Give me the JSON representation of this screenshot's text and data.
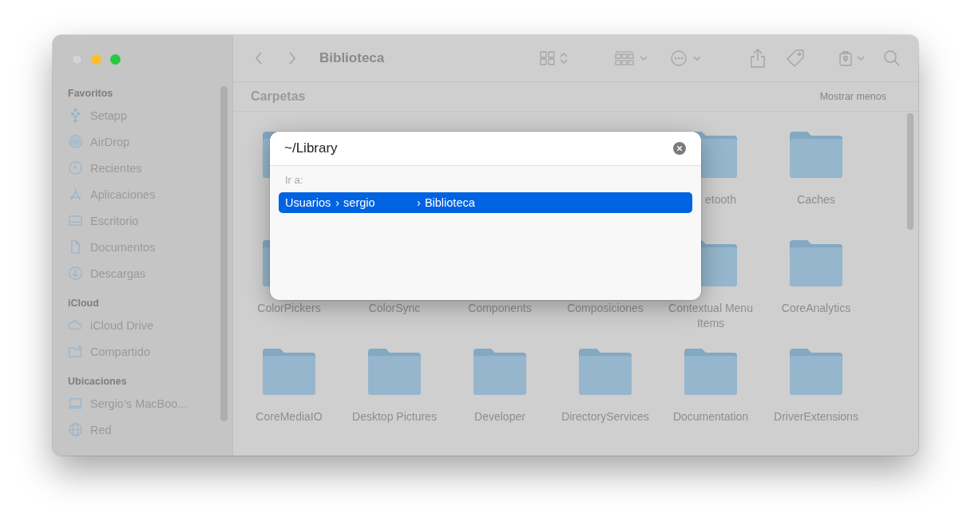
{
  "window": {
    "title": "Biblioteca"
  },
  "sidebar": {
    "sections": [
      {
        "heading": "Favoritos",
        "items": [
          {
            "label": "Setapp",
            "kind": "setapp"
          },
          {
            "label": "AirDrop",
            "kind": "airdrop"
          },
          {
            "label": "Recientes",
            "kind": "clock"
          },
          {
            "label": "Aplicaciones",
            "kind": "apps"
          },
          {
            "label": "Escritorio",
            "kind": "desktop"
          },
          {
            "label": "Documentos",
            "kind": "doc"
          },
          {
            "label": "Descargas",
            "kind": "download"
          }
        ]
      },
      {
        "heading": "iCloud",
        "items": [
          {
            "label": "iCloud Drive",
            "kind": "cloud"
          },
          {
            "label": "Compartido",
            "kind": "shared"
          }
        ]
      },
      {
        "heading": "Ubicaciones",
        "items": [
          {
            "label": "Sergio’s MacBoo...",
            "kind": "laptop"
          },
          {
            "label": "Red",
            "kind": "globe"
          }
        ]
      }
    ]
  },
  "section": {
    "title": "Carpetas",
    "toggle": "Mostrar menos"
  },
  "folders": [
    {
      "kind": "peek"
    },
    {
      "kind": "covered"
    },
    {
      "kind": "covered"
    },
    {
      "kind": "covered"
    },
    {
      "kind": "folder",
      "label": "etooth",
      "cut": true
    },
    {
      "kind": "folder",
      "label": "Caches"
    },
    {
      "kind": "folder",
      "label": "ColorPickers"
    },
    {
      "kind": "label_only",
      "label": "ColorSync"
    },
    {
      "kind": "label_only",
      "label": "Components"
    },
    {
      "kind": "label_only",
      "label": "Composiciones"
    },
    {
      "kind": "folder",
      "label": "Contextual Menu Items"
    },
    {
      "kind": "folder",
      "label": "CoreAnalytics"
    },
    {
      "label": "CoreMediaIO"
    },
    {
      "label": "Desktop Pictures"
    },
    {
      "label": "Developer"
    },
    {
      "label": "DirectoryServices"
    },
    {
      "label": "Documentation"
    },
    {
      "label": "DriverExtensions"
    }
  ],
  "go_dialog": {
    "value": "~/Library",
    "heading": "Ir a:",
    "separator": "›",
    "suggestions": [
      {
        "segments": [
          "Usuarios",
          "sergio",
          "Biblioteca"
        ],
        "selected": true
      }
    ]
  }
}
